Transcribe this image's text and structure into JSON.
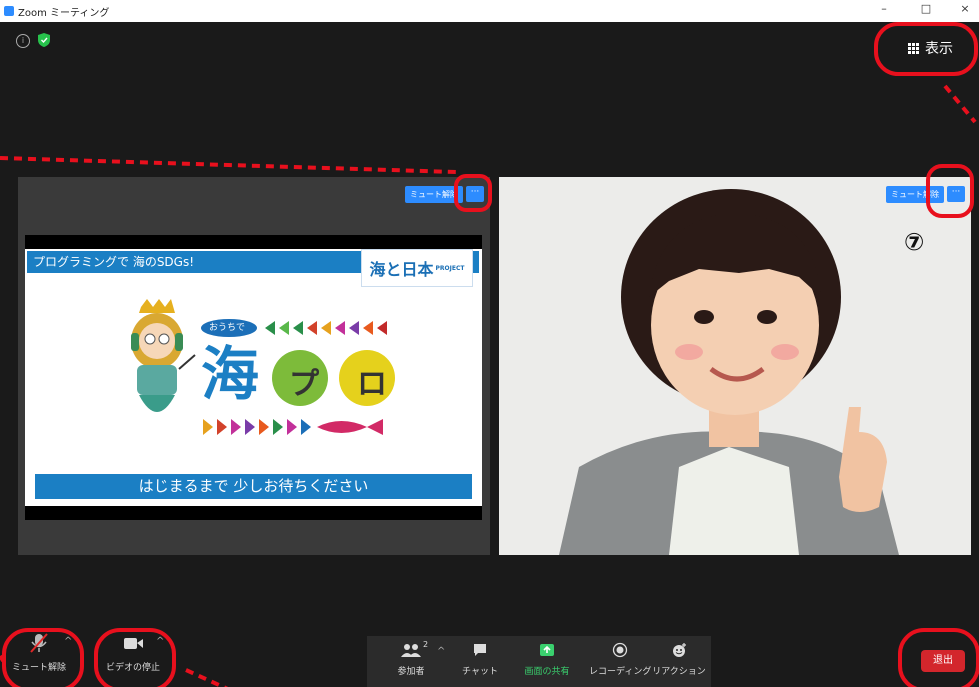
{
  "window": {
    "title": "Zoom ミーティング",
    "minimize": "–",
    "maximize": "□",
    "close": "×"
  },
  "top": {
    "view_label": "表示"
  },
  "tiles": [
    {
      "unmute_label": "ミュート解除",
      "more_label": "···"
    },
    {
      "unmute_label": "ミュート解除",
      "more_label": "···"
    }
  ],
  "slide": {
    "top_banner": "プログラミングで 海のSDGs!",
    "logo": "海と日本",
    "logo_sub": "PROJECT",
    "tag": "おうちで",
    "main_title": "海",
    "main_title_2": "プロ",
    "bottom_banner": "はじまるまで 少しお待ちください"
  },
  "marker": "⑦",
  "toolbar": {
    "mute_label": "ミュート解除",
    "video_label": "ビデオの停止",
    "participants_label": "参加者",
    "participants_count": "2",
    "chat_label": "チャット",
    "share_label": "画面の共有",
    "record_label": "レコーディング",
    "reaction_label": "リアクション",
    "leave_label": "退出"
  },
  "colors": {
    "accent": "#2d8cff",
    "share_green": "#3ad06e",
    "leave_red": "#d3262c",
    "annotation_red": "#e8101d"
  }
}
